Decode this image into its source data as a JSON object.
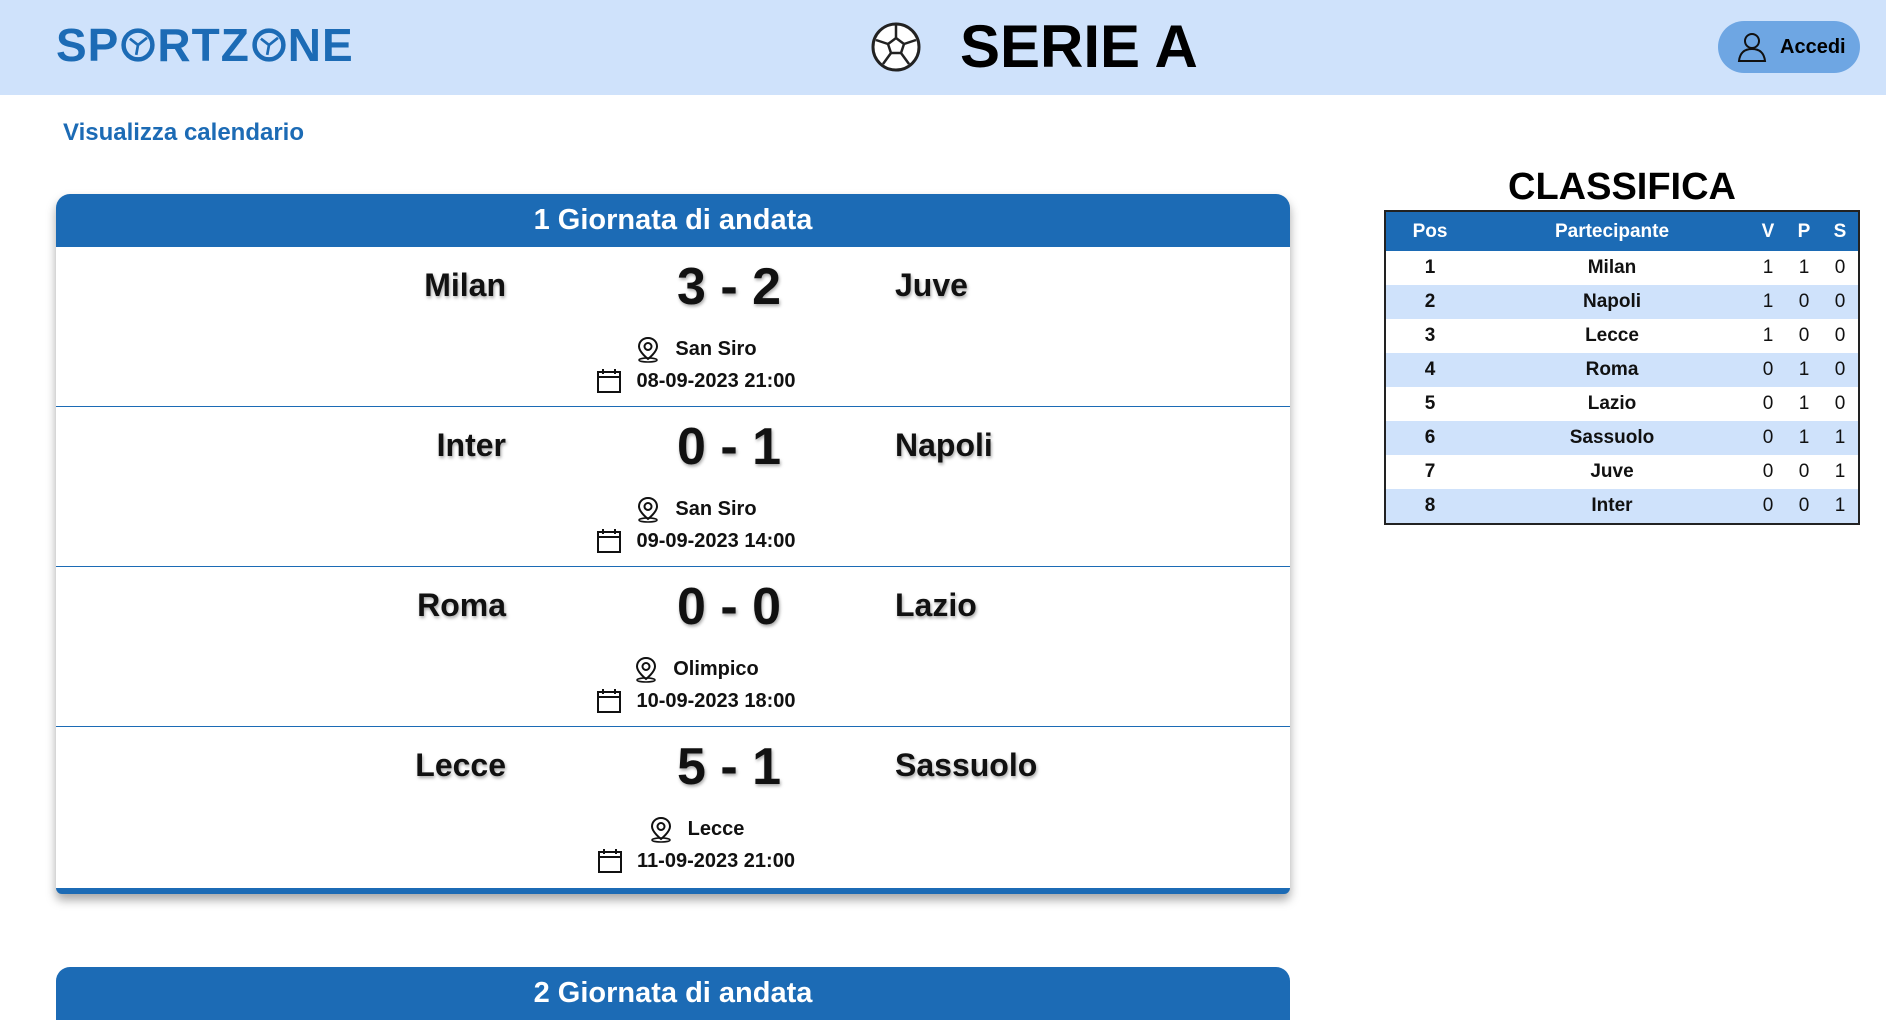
{
  "header": {
    "logo_left": "SP",
    "logo_mid": "RTZ",
    "logo_right": "NE",
    "title": "SERIE A",
    "login_label": "Accedi"
  },
  "nav": {
    "calendar_link": "Visualizza calendario"
  },
  "rounds": [
    {
      "title": "1 Giornata di andata",
      "matches": [
        {
          "home": "Milan",
          "score": "3 - 2",
          "away": "Juve",
          "venue": "San Siro",
          "datetime": "08-09-2023 21:00"
        },
        {
          "home": "Inter",
          "score": "0 - 1",
          "away": "Napoli",
          "venue": "San Siro",
          "datetime": "09-09-2023 14:00"
        },
        {
          "home": "Roma",
          "score": "0 - 0",
          "away": "Lazio",
          "venue": "Olimpico",
          "datetime": "10-09-2023 18:00"
        },
        {
          "home": "Lecce",
          "score": "5 - 1",
          "away": "Sassuolo",
          "venue": "Lecce",
          "datetime": "11-09-2023 21:00"
        }
      ]
    },
    {
      "title": "2 Giornata di andata"
    }
  ],
  "standings": {
    "title": "CLASSIFICA",
    "headers": {
      "pos": "Pos",
      "team": "Partecipante",
      "v": "V",
      "p": "P",
      "s": "S"
    },
    "rows": [
      {
        "pos": "1",
        "team": "Milan",
        "v": "1",
        "p": "1",
        "s": "0"
      },
      {
        "pos": "2",
        "team": "Napoli",
        "v": "1",
        "p": "0",
        "s": "0"
      },
      {
        "pos": "3",
        "team": "Lecce",
        "v": "1",
        "p": "0",
        "s": "0"
      },
      {
        "pos": "4",
        "team": "Roma",
        "v": "0",
        "p": "1",
        "s": "0"
      },
      {
        "pos": "5",
        "team": "Lazio",
        "v": "0",
        "p": "1",
        "s": "0"
      },
      {
        "pos": "6",
        "team": "Sassuolo",
        "v": "0",
        "p": "1",
        "s": "1"
      },
      {
        "pos": "7",
        "team": "Juve",
        "v": "0",
        "p": "0",
        "s": "1"
      },
      {
        "pos": "8",
        "team": "Inter",
        "v": "0",
        "p": "0",
        "s": "1"
      }
    ]
  },
  "colors": {
    "primary": "#1c6bb5",
    "header_bg": "#cfe2fb",
    "login_bg": "#6ea6e3",
    "row_alt": "#cfe2fb"
  },
  "icons": {
    "logo_o": "soccer-ball-icon",
    "title": "soccer-ball-icon",
    "login": "user-icon",
    "venue": "map-pin-icon",
    "date": "calendar-icon"
  }
}
